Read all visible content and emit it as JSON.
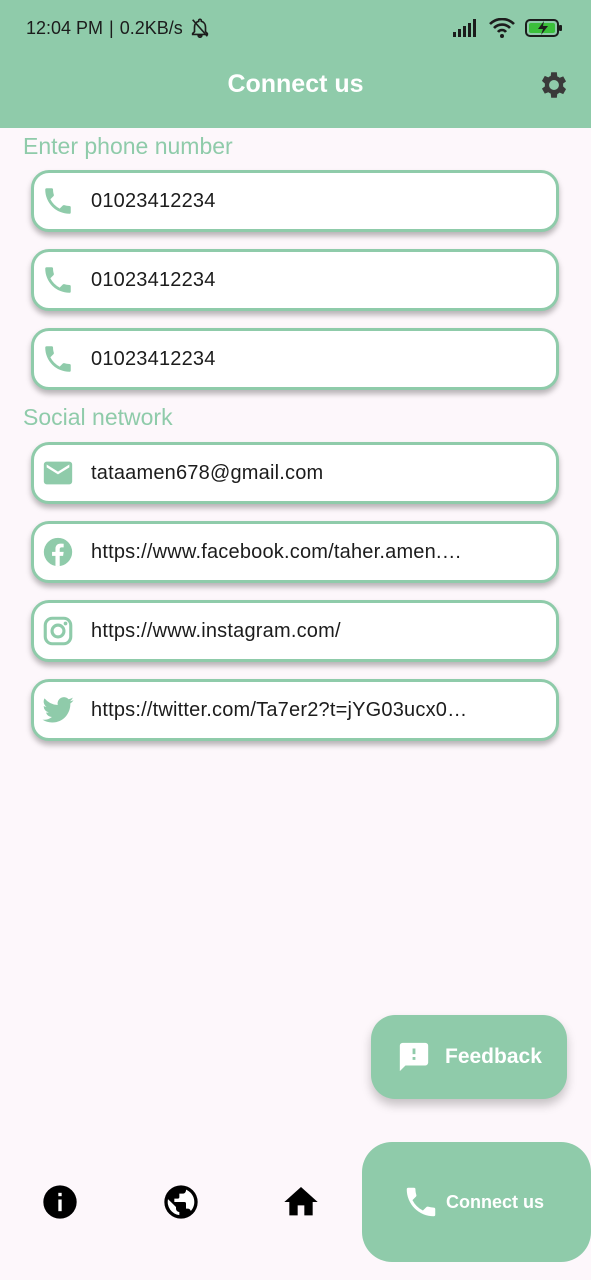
{
  "status_bar": {
    "time": "12:04 PM",
    "speed": "0.2KB/s"
  },
  "app_bar": {
    "title": "Connect us",
    "settings_icon": "gear-icon"
  },
  "phone_section": {
    "title": "Enter phone number",
    "numbers": [
      "01023412234",
      "01023412234",
      "01023412234"
    ]
  },
  "social_section": {
    "title": "Social network",
    "email": "tataamen678@gmail.com",
    "facebook": "https://www.facebook.com/taher.amen.…",
    "instagram": "https://www.instagram.com/",
    "twitter": "https://twitter.com/Ta7er2?t=jYG03ucx0…"
  },
  "fab": {
    "label": "Feedback"
  },
  "bottom_nav": {
    "active_label": "Connect us",
    "items": [
      "info-icon",
      "globe-icon",
      "home-icon",
      "phone-icon"
    ]
  },
  "colors": {
    "accent": "#8fcbaa",
    "background": "#fdf7fb"
  }
}
